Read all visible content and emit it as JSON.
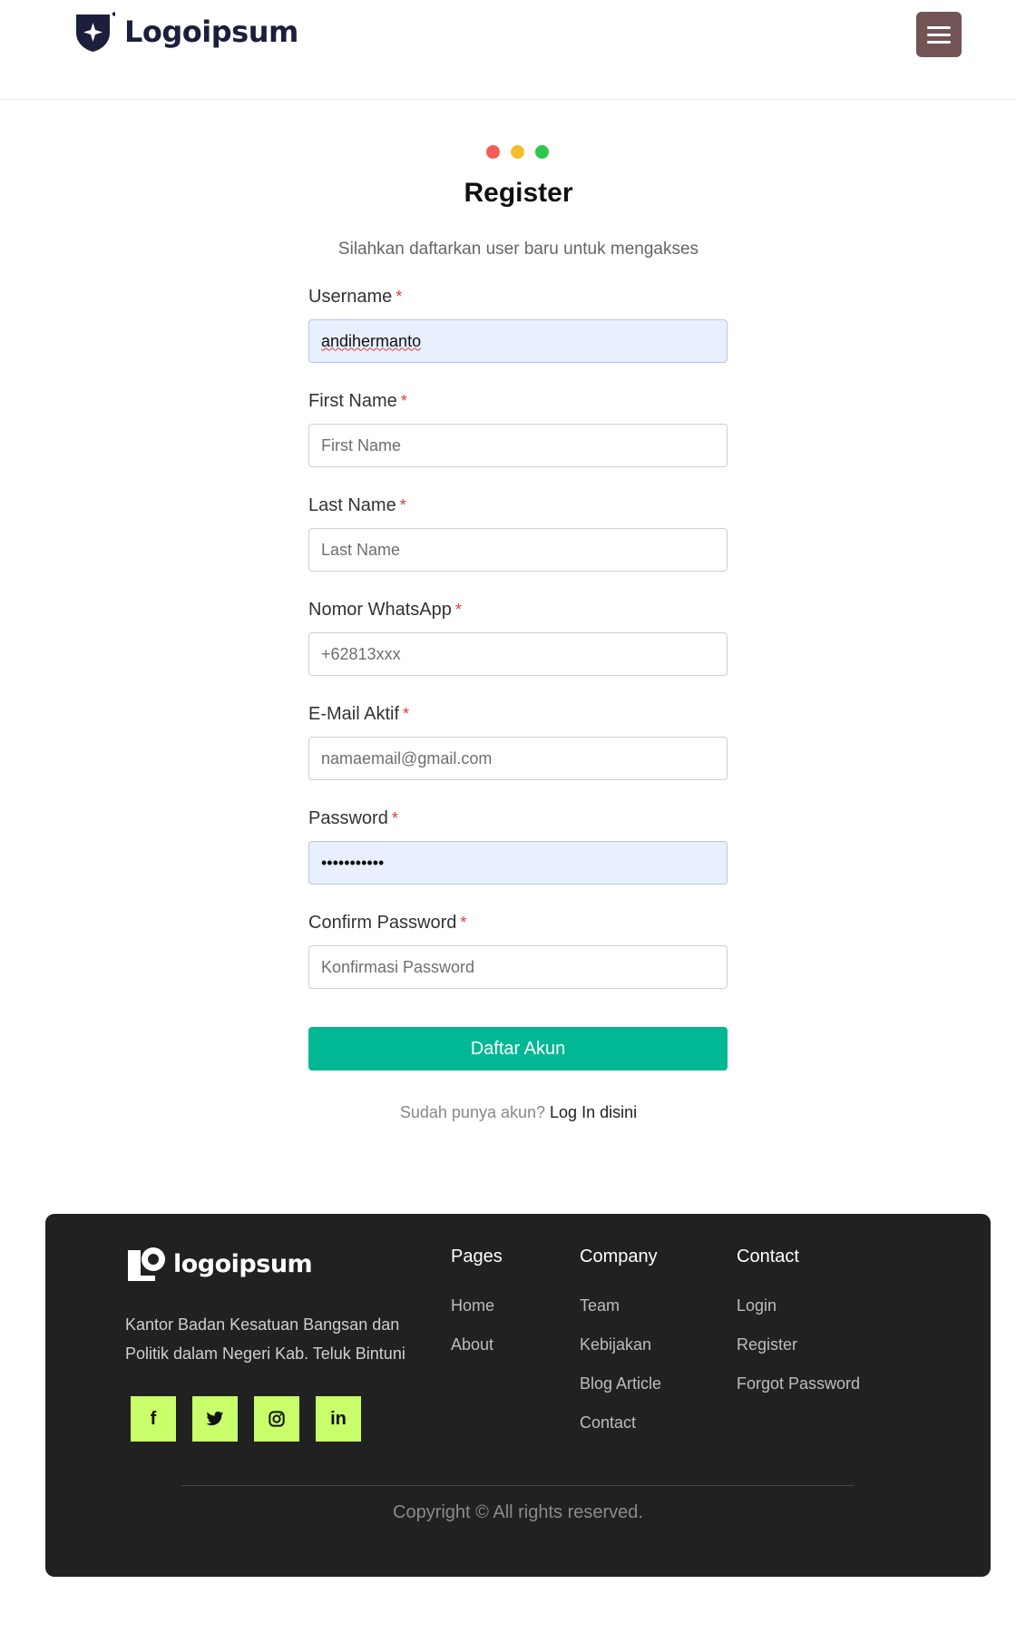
{
  "header": {
    "brand": "Logoipsum",
    "menu_icon": "hamburger-menu-icon"
  },
  "register": {
    "title": "Register",
    "subtitle": "Silahkan daftarkan user baru untuk mengakses",
    "dots": [
      "#f25c54",
      "#f5bd2c",
      "#2cc84a"
    ],
    "required_mark": "*",
    "fields": {
      "username": {
        "label": "Username",
        "value": "andihermanto",
        "placeholder": ""
      },
      "first_name": {
        "label": "First Name",
        "value": "",
        "placeholder": "First Name"
      },
      "last_name": {
        "label": "Last Name",
        "value": "",
        "placeholder": "Last Name"
      },
      "whatsapp": {
        "label": "Nomor WhatsApp",
        "value": "",
        "placeholder": "+62813xxx"
      },
      "email": {
        "label": "E-Mail Aktif",
        "value": "",
        "placeholder": "namaemail@gmail.com"
      },
      "password": {
        "label": "Password",
        "value": "•••••••••••",
        "placeholder": ""
      },
      "confirm_password": {
        "label": "Confirm Password",
        "value": "",
        "placeholder": "Konfirmasi Password"
      }
    },
    "submit_label": "Daftar Akun",
    "login_prompt": "Sudah punya akun?",
    "login_link": "Log In disini",
    "accent_color": "#00b894"
  },
  "footer": {
    "brand": "logoipsum",
    "description": "Kantor Badan Kesatuan Bangsan dan Politik dalam Negeri Kab. Teluk Bintuni",
    "socials": [
      {
        "name": "facebook-icon",
        "glyph": "f"
      },
      {
        "name": "twitter-icon",
        "glyph": "🐦"
      },
      {
        "name": "instagram-icon",
        "glyph": "◎"
      },
      {
        "name": "linkedin-icon",
        "glyph": "in"
      }
    ],
    "columns": {
      "pages": {
        "title": "Pages",
        "links": [
          "Home",
          "About"
        ]
      },
      "company": {
        "title": "Company",
        "links": [
          "Team",
          "Kebijakan",
          "Blog Article",
          "Contact"
        ]
      },
      "contact": {
        "title": "Contact",
        "links": [
          "Login",
          "Register",
          "Forgot Password"
        ]
      }
    },
    "copyright": "Copyright © All rights reserved.",
    "social_color": "#c8ff6a",
    "background": "#212121"
  }
}
